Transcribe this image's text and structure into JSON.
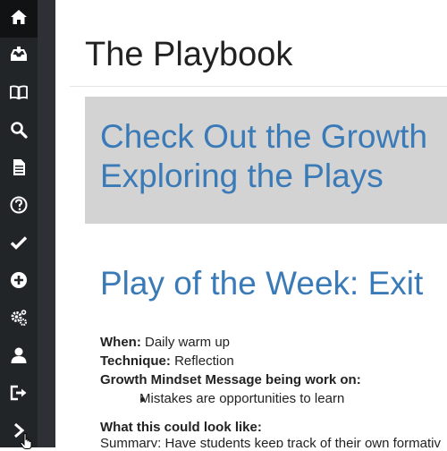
{
  "sidebar": {
    "items": [
      {
        "icon": "home-icon",
        "label": "Home"
      },
      {
        "icon": "inbox-icon",
        "label": "Inbox"
      },
      {
        "icon": "book-icon",
        "label": "Book"
      },
      {
        "icon": "search-icon",
        "label": "Search"
      },
      {
        "icon": "document-icon",
        "label": "Document"
      },
      {
        "icon": "help-icon",
        "label": "Help"
      },
      {
        "icon": "checkmark-icon",
        "label": "Check"
      },
      {
        "icon": "add-icon",
        "label": "Add"
      },
      {
        "icon": "settings-gears-icon",
        "label": "Settings"
      },
      {
        "icon": "user-icon",
        "label": "User"
      },
      {
        "icon": "logout-icon",
        "label": "Logout"
      },
      {
        "icon": "chevron-right-icon",
        "label": "Expand"
      }
    ]
  },
  "main": {
    "page_title": "The Playbook",
    "banner": {
      "line1": "Check Out the Growth",
      "line2": "Exploring the Plays"
    },
    "section_title": "Play of the Week: Exit",
    "details": {
      "when_label": "When:",
      "when_value": "Daily warm up",
      "technique_label": "Technique:",
      "technique_value": "Reflection",
      "message_label": "Growth Mindset Message being work on:",
      "message_bullet": "Mistakes are opportunities to learn",
      "look_label": "What this could look like:",
      "summary": "Summary: Have students keep track of their own formativ"
    }
  },
  "colors": {
    "sidebar_bg": "#222528",
    "heading_blue": "#3a7ab7",
    "banner_gray": "#d3d3d3"
  }
}
